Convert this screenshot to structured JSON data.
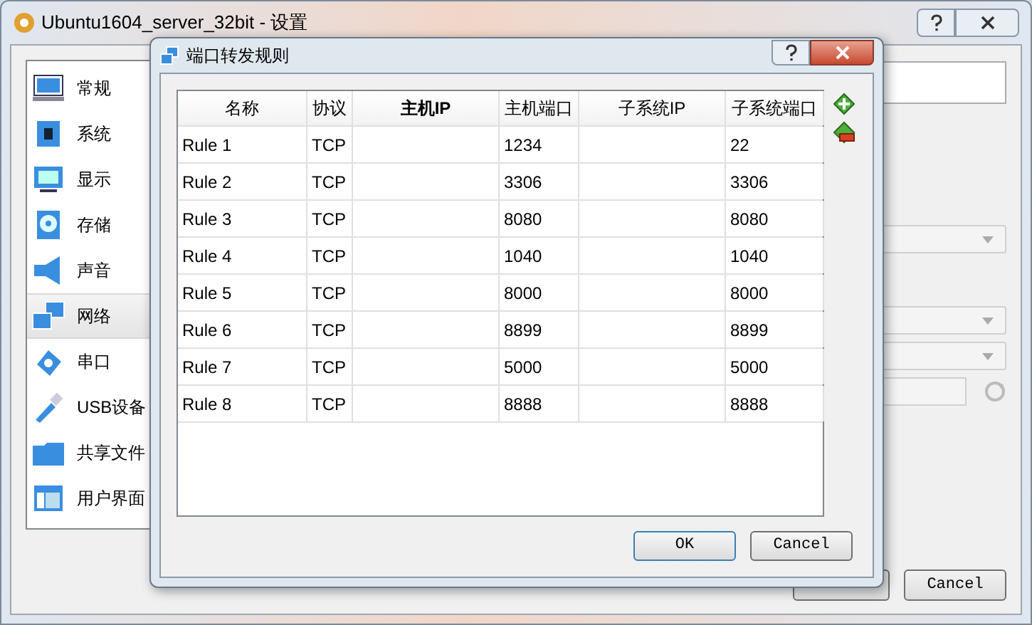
{
  "window": {
    "title": "Ubuntu1604_server_32bit - 设置"
  },
  "sidebar": {
    "items": [
      {
        "label": "常规",
        "selected": false
      },
      {
        "label": "系统",
        "selected": false
      },
      {
        "label": "显示",
        "selected": false
      },
      {
        "label": "存储",
        "selected": false
      },
      {
        "label": "声音",
        "selected": false
      },
      {
        "label": "网络",
        "selected": true
      },
      {
        "label": "串口",
        "selected": false
      },
      {
        "label": "USB设备",
        "selected": false
      },
      {
        "label": "共享文件",
        "selected": false
      },
      {
        "label": "用户界面",
        "selected": false
      }
    ]
  },
  "settings_fields": [
    {
      "kind": "text",
      "disabled": false
    },
    {
      "kind": "dropdown",
      "disabled": true
    },
    {
      "kind": "dropdown",
      "disabled": true
    },
    {
      "kind": "dropdown",
      "disabled": true
    },
    {
      "kind": "text",
      "disabled": true
    }
  ],
  "buttons": [
    "Cancel"
  ],
  "dialog": {
    "title": "端口转发规则",
    "table": {
      "columns": [
        {
          "label": "名称",
          "bold": false
        },
        {
          "label": "协议",
          "bold": false
        },
        {
          "label": "主机IP",
          "bold": true
        },
        {
          "label": "主机端口",
          "bold": false
        },
        {
          "label": "子系统IP",
          "bold": false
        },
        {
          "label": "子系统端口",
          "bold": false
        }
      ],
      "rows": [
        [
          "Rule 1",
          "TCP",
          "",
          "1234",
          "",
          "22"
        ],
        [
          "Rule 2",
          "TCP",
          "",
          "3306",
          "",
          "3306"
        ],
        [
          "Rule 3",
          "TCP",
          "",
          "8080",
          "",
          "8080"
        ],
        [
          "Rule 4",
          "TCP",
          "",
          "1040",
          "",
          "1040"
        ],
        [
          "Rule 5",
          "TCP",
          "",
          "8000",
          "",
          "8000"
        ],
        [
          "Rule 6",
          "TCP",
          "",
          "8899",
          "",
          "8899"
        ],
        [
          "Rule 7",
          "TCP",
          "",
          "5000",
          "",
          "5000"
        ],
        [
          "Rule 8",
          "TCP",
          "",
          "8888",
          "",
          "8888"
        ]
      ]
    },
    "buttons": [
      "OK",
      "Cancel"
    ]
  }
}
